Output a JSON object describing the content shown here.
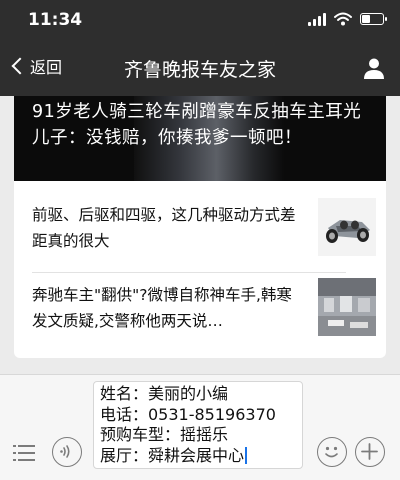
{
  "status_bar": {
    "time": "11:34",
    "icons": [
      "signal-icon",
      "wifi-icon",
      "battery-icon"
    ]
  },
  "nav": {
    "back_label": "返回",
    "title": "齐鲁晚报车友之家",
    "back_icon": "chevron-left-icon",
    "profile_icon": "person-icon"
  },
  "card": {
    "hero": {
      "title": "91岁老人骑三轮车剐蹭豪车反抽车主耳光 儿子：没钱赔，你揍我爹一顿吧！"
    },
    "articles": [
      {
        "title": "前驱、后驱和四驱，这几种驱动方式差距真的很大",
        "thumb_icon": "car-chassis-thumbnail"
      },
      {
        "title": "奔驰车主\"翻供\"?微博自称神车手,韩寒发文质疑,交警称他两天说…",
        "thumb_icon": "exhibition-hall-thumbnail"
      }
    ]
  },
  "input": {
    "lines": [
      "姓名：美丽的小编",
      "电话：0531-85196370",
      "预购车型：摇摇乐",
      "展厅：舜耕会展中心"
    ]
  },
  "bottom_icons": [
    "menu-icon",
    "voice-icon",
    "emoji-icon",
    "plus-icon"
  ],
  "colors": {
    "header_bg": "#2e2e2e",
    "page_bg": "#ebebeb",
    "cursor": "#1a73e8"
  }
}
